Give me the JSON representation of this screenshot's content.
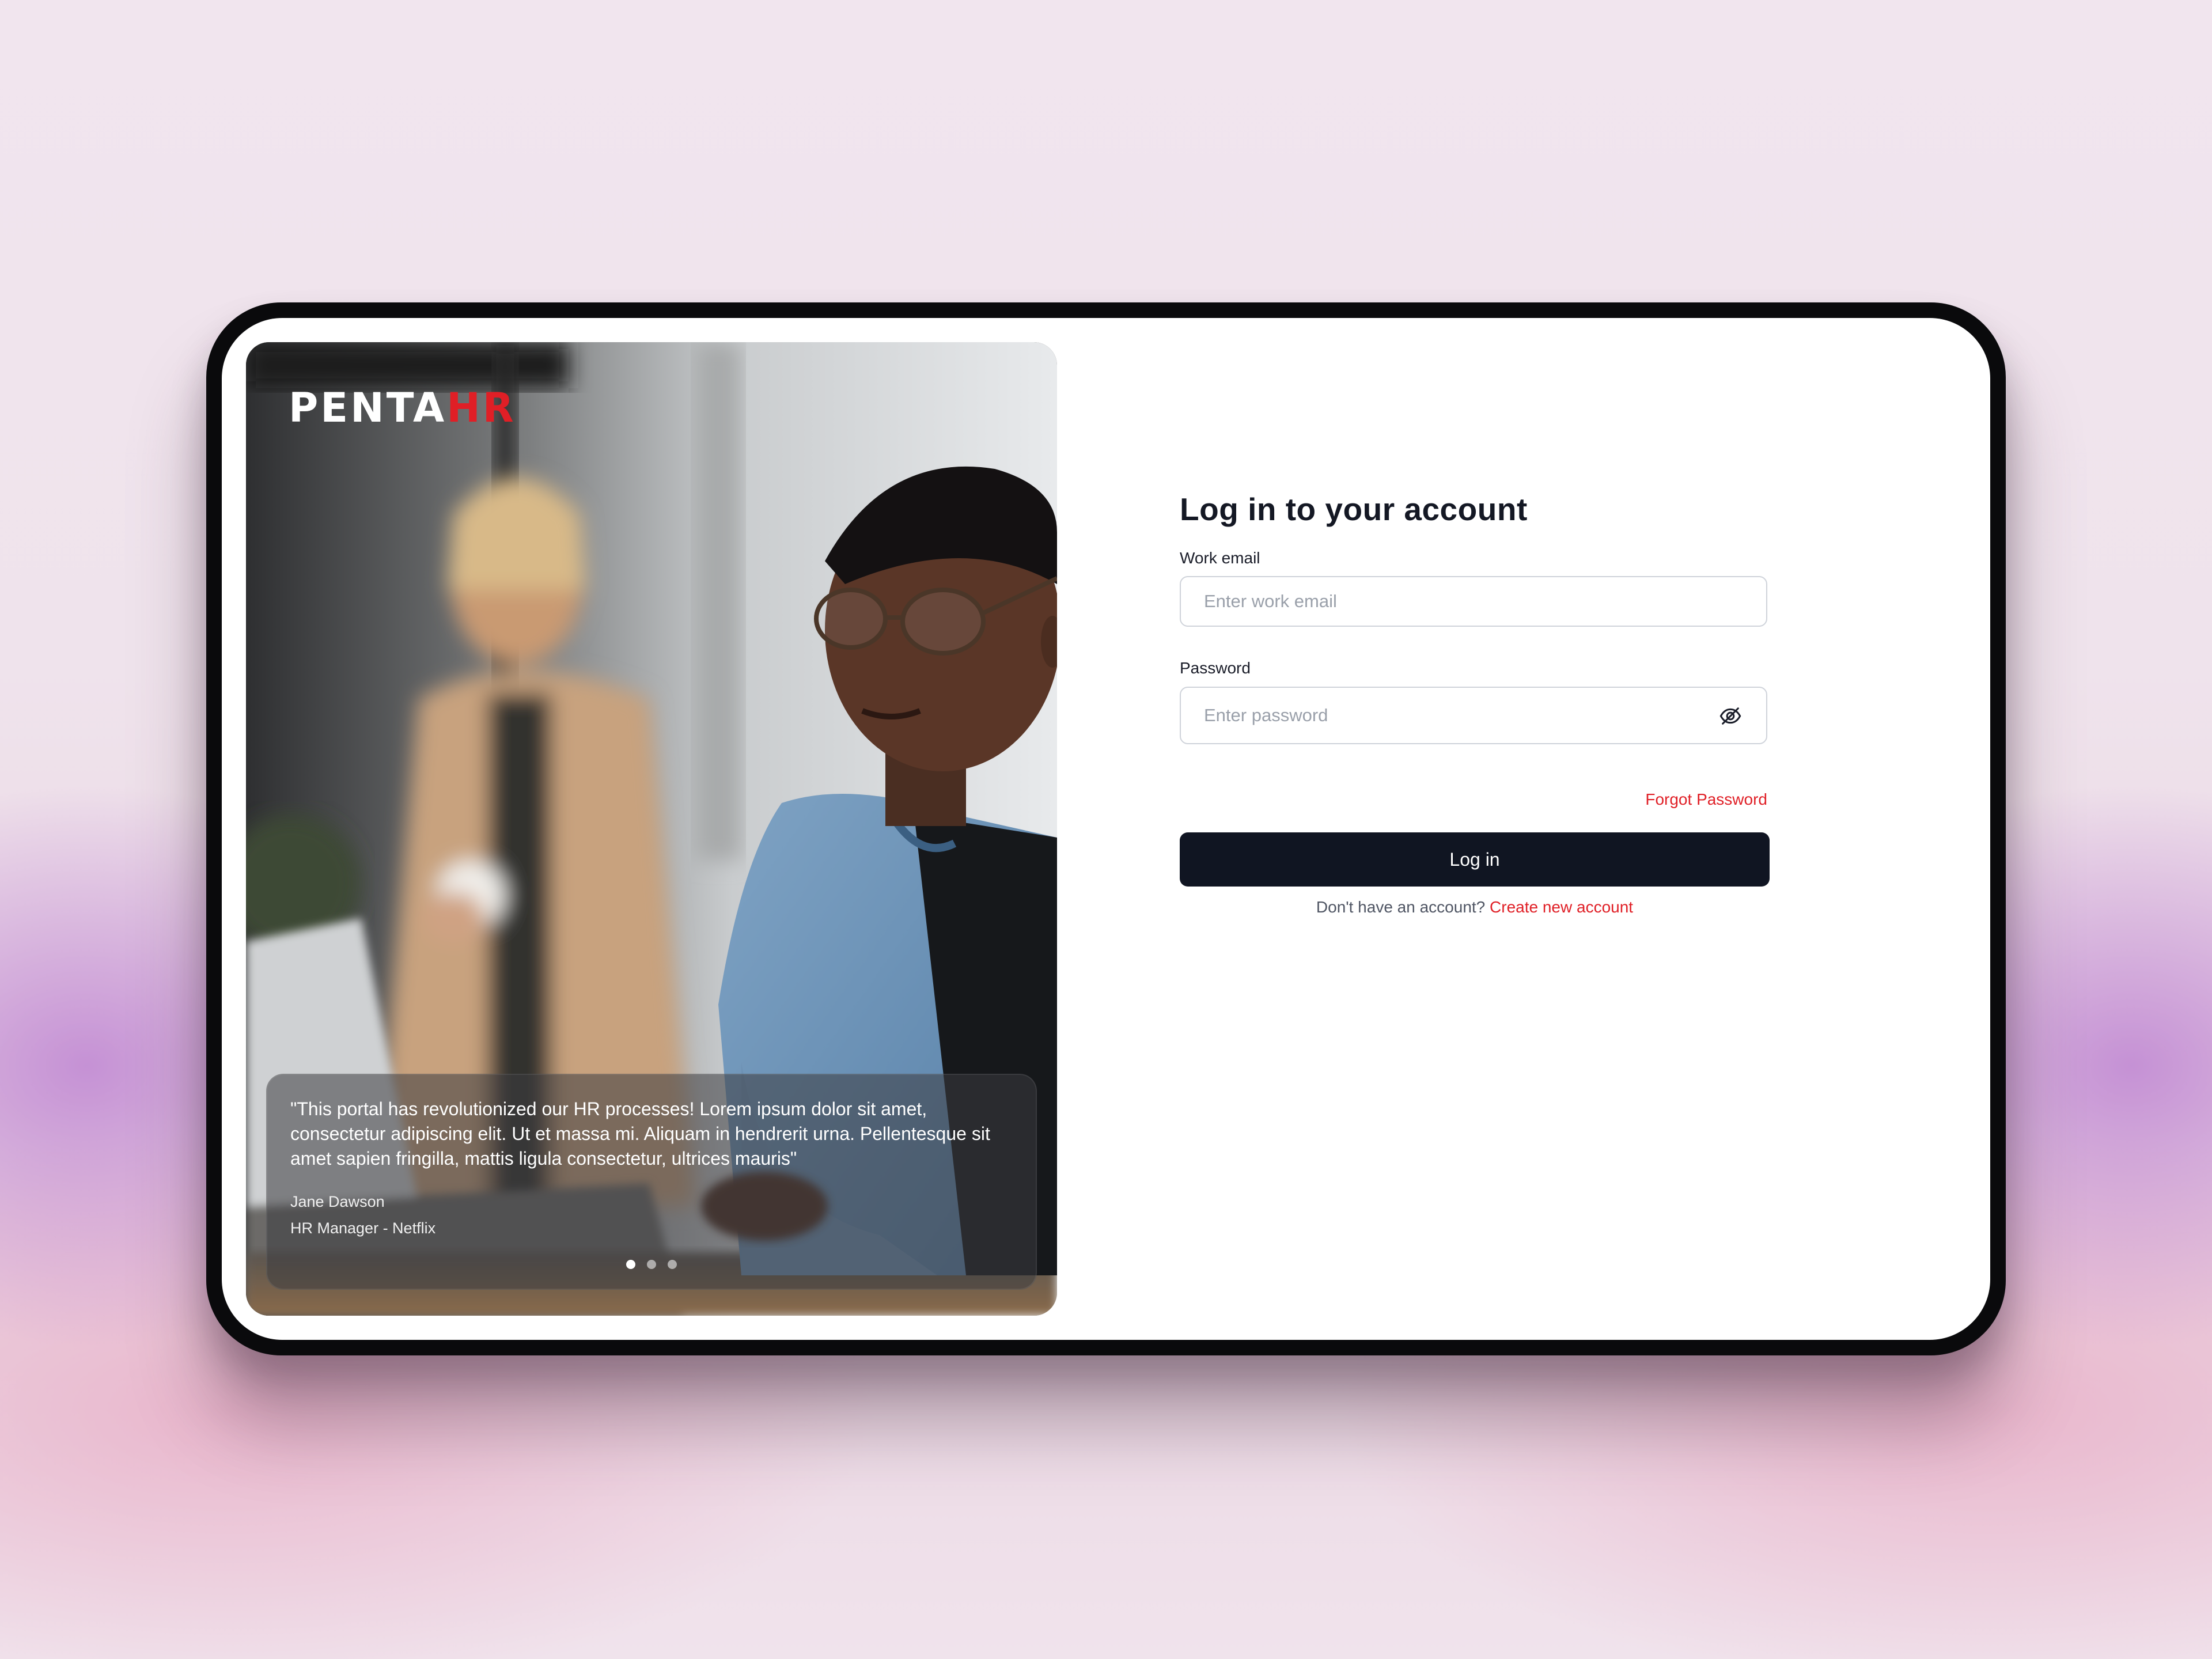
{
  "brand": {
    "logo_main": "PENTA",
    "logo_accent": "HR",
    "accent_color": "#e01f26",
    "dark_color": "#101522"
  },
  "testimonial": {
    "quote": "\"This portal has revolutionized our HR processes! Lorem ipsum dolor sit amet, consectetur adipiscing elit. Ut et massa mi. Aliquam in hendrerit urna. Pellentesque sit amet sapien fringilla, mattis ligula consectetur, ultrices mauris\"",
    "author": "Jane Dawson",
    "role": "HR Manager - Netflix",
    "slides_total": 3,
    "active_slide": 1
  },
  "login": {
    "title": "Log in to your account",
    "email_label": "Work email",
    "email_placeholder": "Enter work email",
    "email_value": "",
    "password_label": "Password",
    "password_placeholder": "Enter password",
    "password_value": "",
    "password_toggle_icon": "eye-off-icon",
    "forgot_label": "Forgot Password",
    "submit_label": "Log in",
    "signup_prompt": "Don't have an account?",
    "signup_link": "Create new account"
  }
}
